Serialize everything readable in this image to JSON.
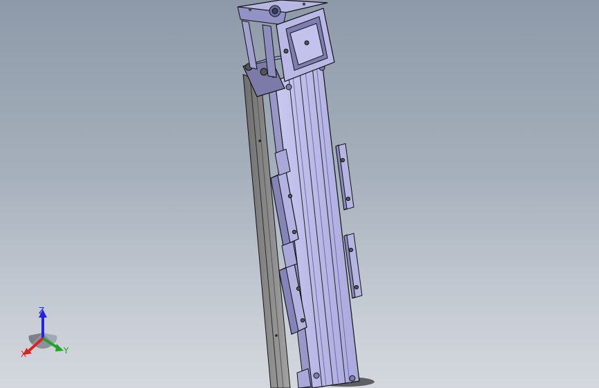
{
  "viewport": {
    "background_top": "#8e9aa9",
    "background_bottom": "#d4d8de"
  },
  "model": {
    "body_color": "#b7b6e4",
    "body_shade": "#8f8ec0",
    "rail_color": "#8c8c8c",
    "edge_color": "#111111"
  },
  "triad": {
    "z_label": "Z",
    "y_label": "Y",
    "x_label": "X",
    "z_color": "#2323e6",
    "y_color": "#1fa51f",
    "x_color": "#e02020"
  }
}
